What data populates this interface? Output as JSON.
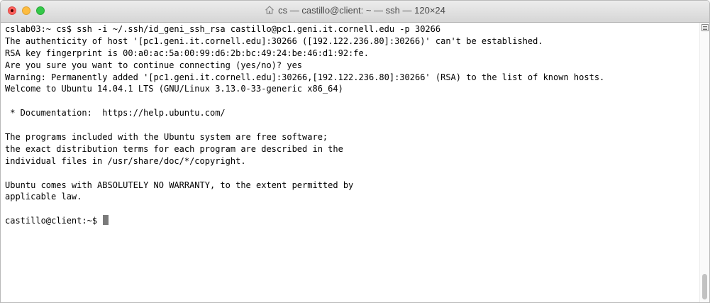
{
  "window": {
    "title": "cs — castillo@client: ~ — ssh — 120×24",
    "title_icon": "home-icon",
    "buttons": [
      "close",
      "minimize",
      "zoom"
    ]
  },
  "terminal": {
    "lines": [
      "cslab03:~ cs$ ssh -i ~/.ssh/id_geni_ssh_rsa castillo@pc1.geni.it.cornell.edu -p 30266",
      "The authenticity of host '[pc1.geni.it.cornell.edu]:30266 ([192.122.236.80]:30266)' can't be established.",
      "RSA key fingerprint is 00:a0:ac:5a:00:99:d6:2b:bc:49:24:be:46:d1:92:fe.",
      "Are you sure you want to continue connecting (yes/no)? yes",
      "Warning: Permanently added '[pc1.geni.it.cornell.edu]:30266,[192.122.236.80]:30266' (RSA) to the list of known hosts.",
      "Welcome to Ubuntu 14.04.1 LTS (GNU/Linux 3.13.0-33-generic x86_64)",
      "",
      " * Documentation:  https://help.ubuntu.com/",
      "",
      "The programs included with the Ubuntu system are free software;",
      "the exact distribution terms for each program are described in the",
      "individual files in /usr/share/doc/*/copyright.",
      "",
      "Ubuntu comes with ABSOLUTELY NO WARRANTY, to the extent permitted by",
      "applicable law.",
      ""
    ],
    "prompt": "castillo@client:~$ "
  },
  "colors": {
    "background": "#ffffff",
    "text": "#000000",
    "cursor": "#7a7a7a",
    "close": "#fc605c",
    "minimize": "#fdbc40",
    "zoom": "#34c84a"
  }
}
